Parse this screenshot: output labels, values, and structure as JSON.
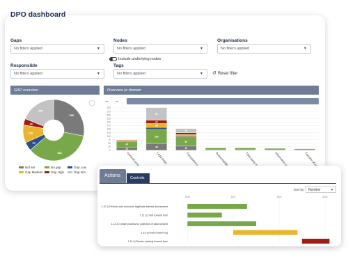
{
  "dashboard": {
    "title": "DPO dashboard",
    "filters": {
      "gaps": {
        "label": "Gaps",
        "value": "No filters applied"
      },
      "nodes": {
        "label": "Nodes",
        "value": "No filters applied"
      },
      "organisations": {
        "label": "Organisations",
        "value": "No filters applied"
      },
      "responsible": {
        "label": "Responsible",
        "value": "No filters applied"
      },
      "tags": {
        "label": "Tags",
        "value": "No filters applied"
      },
      "include_underlying": "Include underlying nodes",
      "reset_label": "Reset filter"
    }
  },
  "gap_overview": {
    "title": "GAP overview",
    "slices": [
      {
        "label": "Not set",
        "value": 380,
        "color": "#7a7a7a"
      },
      {
        "label": "No gap",
        "value": 482,
        "color": "#78a84a"
      },
      {
        "label": "Gap Low",
        "value": 62,
        "color": "#2c4f86"
      },
      {
        "label": "Gap Medium",
        "value": 128,
        "color": "#e9b62b"
      },
      {
        "label": "Gap High",
        "value": 46,
        "color": "#a01d13"
      },
      {
        "label": "Gap N/A",
        "value": 255,
        "color": "#c3c3c3"
      }
    ],
    "legend": [
      "Not set",
      "No gap",
      "Gap Low",
      "Gap Medium",
      "Gap High",
      "Gap N/A"
    ]
  },
  "domain_overview": {
    "title": "Overview pr domain",
    "chart_data": {
      "type": "bar",
      "stacked": true,
      "categories": [
        "General provisions",
        "Legal basis",
        "Transparency and subject rights",
        "Accountability and privacy",
        "Third party risk",
        "Information security",
        "Transfer of personal data"
      ],
      "ylim": [
        0,
        300
      ],
      "yticks": [
        0,
        25,
        50,
        75,
        100,
        125,
        150,
        175,
        200,
        225,
        250,
        275,
        300
      ],
      "series": [
        {
          "color": "#7a7a7a",
          "values": [
            24,
            48,
            30,
            5,
            5,
            4,
            3
          ]
        },
        {
          "color": "#78a84a",
          "values": [
            40,
            100,
            60,
            12,
            12,
            10,
            8
          ]
        },
        {
          "color": "#2c4f86",
          "values": [
            0,
            14,
            8,
            0,
            0,
            0,
            0
          ]
        },
        {
          "color": "#e9b62b",
          "values": [
            5,
            28,
            14,
            0,
            0,
            0,
            0
          ]
        },
        {
          "color": "#a01d13",
          "values": [
            4,
            22,
            12,
            0,
            0,
            0,
            0
          ]
        },
        {
          "color": "#c3c3c3",
          "values": [
            0,
            90,
            30,
            0,
            0,
            0,
            0
          ]
        }
      ]
    }
  },
  "actions_panel": {
    "tabs": [
      "Actions",
      "Controls"
    ],
    "sort_label": "Sort by",
    "sort_value": "Number",
    "chart_data": {
      "type": "bar",
      "orientation": "horizontal-gantt",
      "x_ticks": [
        "2020",
        "2021",
        "2022",
        "2023"
      ],
      "rows": [
        {
          "label": "1.10 1) Perform and document legitimate interest assessment",
          "start": 2020.0,
          "end": 2021.3,
          "color": "#78a84a"
        },
        {
          "label": "1.11 1) Draft consent form",
          "start": 2020.0,
          "end": 2020.75,
          "color": "#78a84a"
        },
        {
          "label": "1.12 2) Create process for collection of valid consent",
          "start": 2020.0,
          "end": 2021.5,
          "color": "#78a84a"
        },
        {
          "label": "1.13 3) Draft consent log",
          "start": 2021.0,
          "end": 2022.4,
          "color": "#e9b62b"
        },
        {
          "label": "1.14 4) Review existing consent form",
          "start": 2022.5,
          "end": 2023.1,
          "color": "#a01d13"
        }
      ]
    }
  }
}
